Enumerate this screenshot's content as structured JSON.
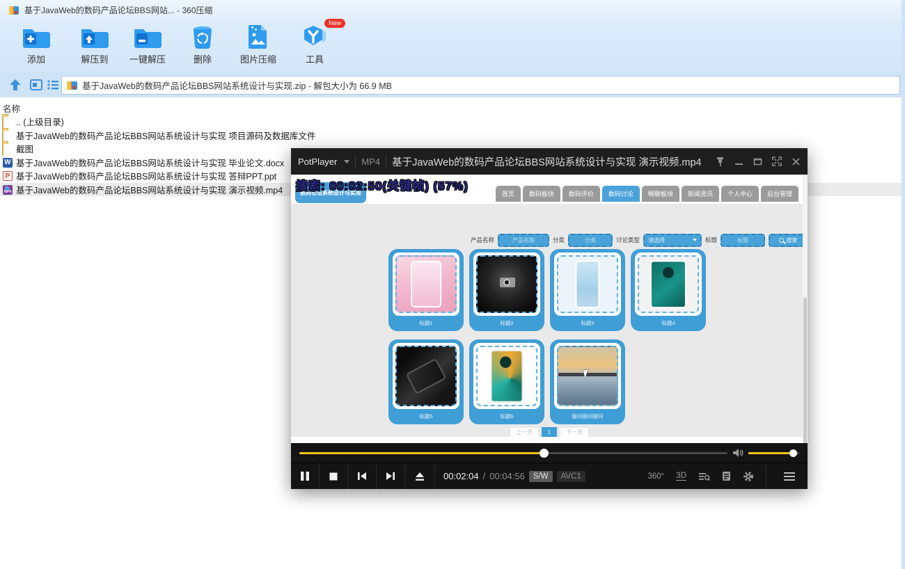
{
  "archiver": {
    "title": "基于JavaWeb的数码产品论坛BBS网站... - 360压缩",
    "toolbar": {
      "add": "添加",
      "extract_to": "解压到",
      "one_click_extract": "一键解压",
      "delete": "删除",
      "image_compress": "图片压缩",
      "tools": "工具",
      "new_badge": "New"
    },
    "address": "基于JavaWeb的数码产品论坛BBS网站系统设计与实现.zip - 解包大小为 66.9 MB",
    "name_column": "名称",
    "file_icon_labels": {
      "docx": "W",
      "ppt": "P",
      "mp4": "MP4"
    },
    "files": [
      {
        "name": ".. (上级目录)",
        "type": "folder"
      },
      {
        "name": "基于JavaWeb的数码产品论坛BBS网站系统设计与实现 项目源码及数据库文件",
        "type": "folder"
      },
      {
        "name": "截图",
        "type": "folder"
      },
      {
        "name": "基于JavaWeb的数码产品论坛BBS网站系统设计与实现 毕业论文.docx",
        "type": "docx"
      },
      {
        "name": "基于JavaWeb的数码产品论坛BBS网站系统设计与实现 答辩PPT.ppt",
        "type": "ppt"
      },
      {
        "name": "基于JavaWeb的数码产品论坛BBS网站系统设计与实现 演示视频.mp4",
        "type": "mp4",
        "selected": true
      }
    ]
  },
  "player": {
    "app": "PotPlayer",
    "format": "MP4",
    "title": "基于JavaWeb的数码产品论坛BBS网站系统设计与实现 演示视频.mp4",
    "osd": "搜索:  00:02:50(关键帧) (57%)",
    "time_current": "00:02:04",
    "time_separator": "/",
    "time_total": "00:04:56",
    "decoder_badge": "S/W",
    "codec_badge": "AVC1",
    "rotate_label": "360°",
    "three_d_label": "3D",
    "progress_percent": 57,
    "volume_percent": 88
  },
  "video_page": {
    "logo": "数码论坛系统设计与实现",
    "nav": [
      "首页",
      "数码板块",
      "数码评价",
      "数码讨论",
      "畅聊板块",
      "新闻资讯",
      "个人中心",
      "后台管理"
    ],
    "active_nav": "数码讨论",
    "form": {
      "product_label": "产品名称",
      "product_value": "产品名称",
      "category_label": "分类",
      "category_value": "分类",
      "type_label": "讨论类型",
      "type_value": "请选择",
      "title_label": "标题",
      "title_value": "标题",
      "search_button": "搜索"
    },
    "cards": [
      {
        "label": "标题1",
        "image": "pink-phone"
      },
      {
        "label": "标题2",
        "image": "man-with-camera"
      },
      {
        "label": "标题3",
        "image": "light-blue-phone"
      },
      {
        "label": "标题4",
        "image": "teal-phone"
      },
      {
        "label": "标题5",
        "image": "black-phone"
      },
      {
        "label": "标题6",
        "image": "teal-phone-2"
      },
      {
        "label": "提问提问提问",
        "image": "sunset-bridge"
      }
    ],
    "pagination": {
      "prev": "上一页",
      "current": "1",
      "next": "下一页"
    }
  }
}
